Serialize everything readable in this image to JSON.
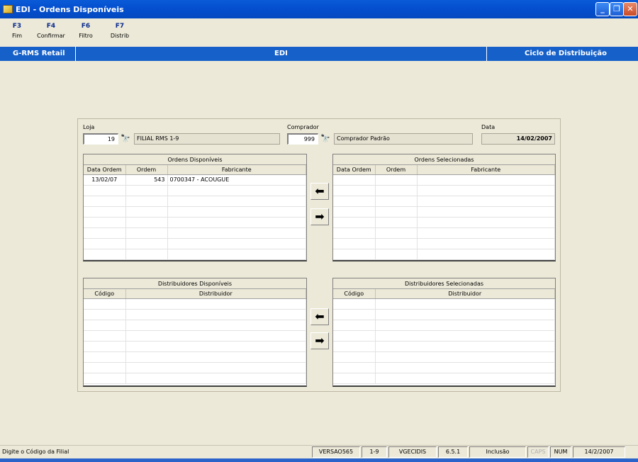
{
  "window": {
    "title": "EDI - Ordens Disponíveis"
  },
  "fkeys": [
    {
      "key": "F3",
      "label": "Fim"
    },
    {
      "key": "F4",
      "label": "Confirmar"
    },
    {
      "key": "F6",
      "label": "Filtro"
    },
    {
      "key": "F7",
      "label": "Distrib"
    }
  ],
  "band": {
    "left": "G-RMS Retail",
    "center": "EDI",
    "right": "Ciclo de Distribuição"
  },
  "form": {
    "loja_label": "Loja",
    "loja_value": "19",
    "loja_desc": "FILIAL RMS 1-9",
    "comprador_label": "Comprador",
    "comprador_value": "999",
    "comprador_desc": "Comprador Padrão",
    "data_label": "Data",
    "data_value": "14/02/2007"
  },
  "ordens_disp": {
    "title": "Ordens Disponíveis",
    "columns": [
      "Data Ordem",
      "Ordem",
      "Fabricante"
    ],
    "rows": [
      [
        "13/02/07",
        "543",
        "0700347 - ACOUGUE"
      ]
    ]
  },
  "ordens_sel": {
    "title": "Ordens Selecionadas",
    "columns": [
      "Data Ordem",
      "Ordem",
      "Fabricante"
    ]
  },
  "dist_disp": {
    "title": "Distribuidores Disponíveis",
    "columns": [
      "Código",
      "Distribuidor"
    ]
  },
  "dist_sel": {
    "title": "Distribuidores Selecionadas",
    "columns": [
      "Código",
      "Distribuidor"
    ]
  },
  "status": {
    "message": "Digite o Código da Filial",
    "cells": [
      "VERSAO565",
      "1-9",
      "VGECIDIS",
      "6.5.1",
      "Inclusão",
      "CAPS",
      "NUM",
      "14/2/2007"
    ]
  },
  "icons": {
    "binoculars": "binoculars-icon",
    "left": "arrow-left-icon",
    "right": "arrow-right-icon"
  }
}
